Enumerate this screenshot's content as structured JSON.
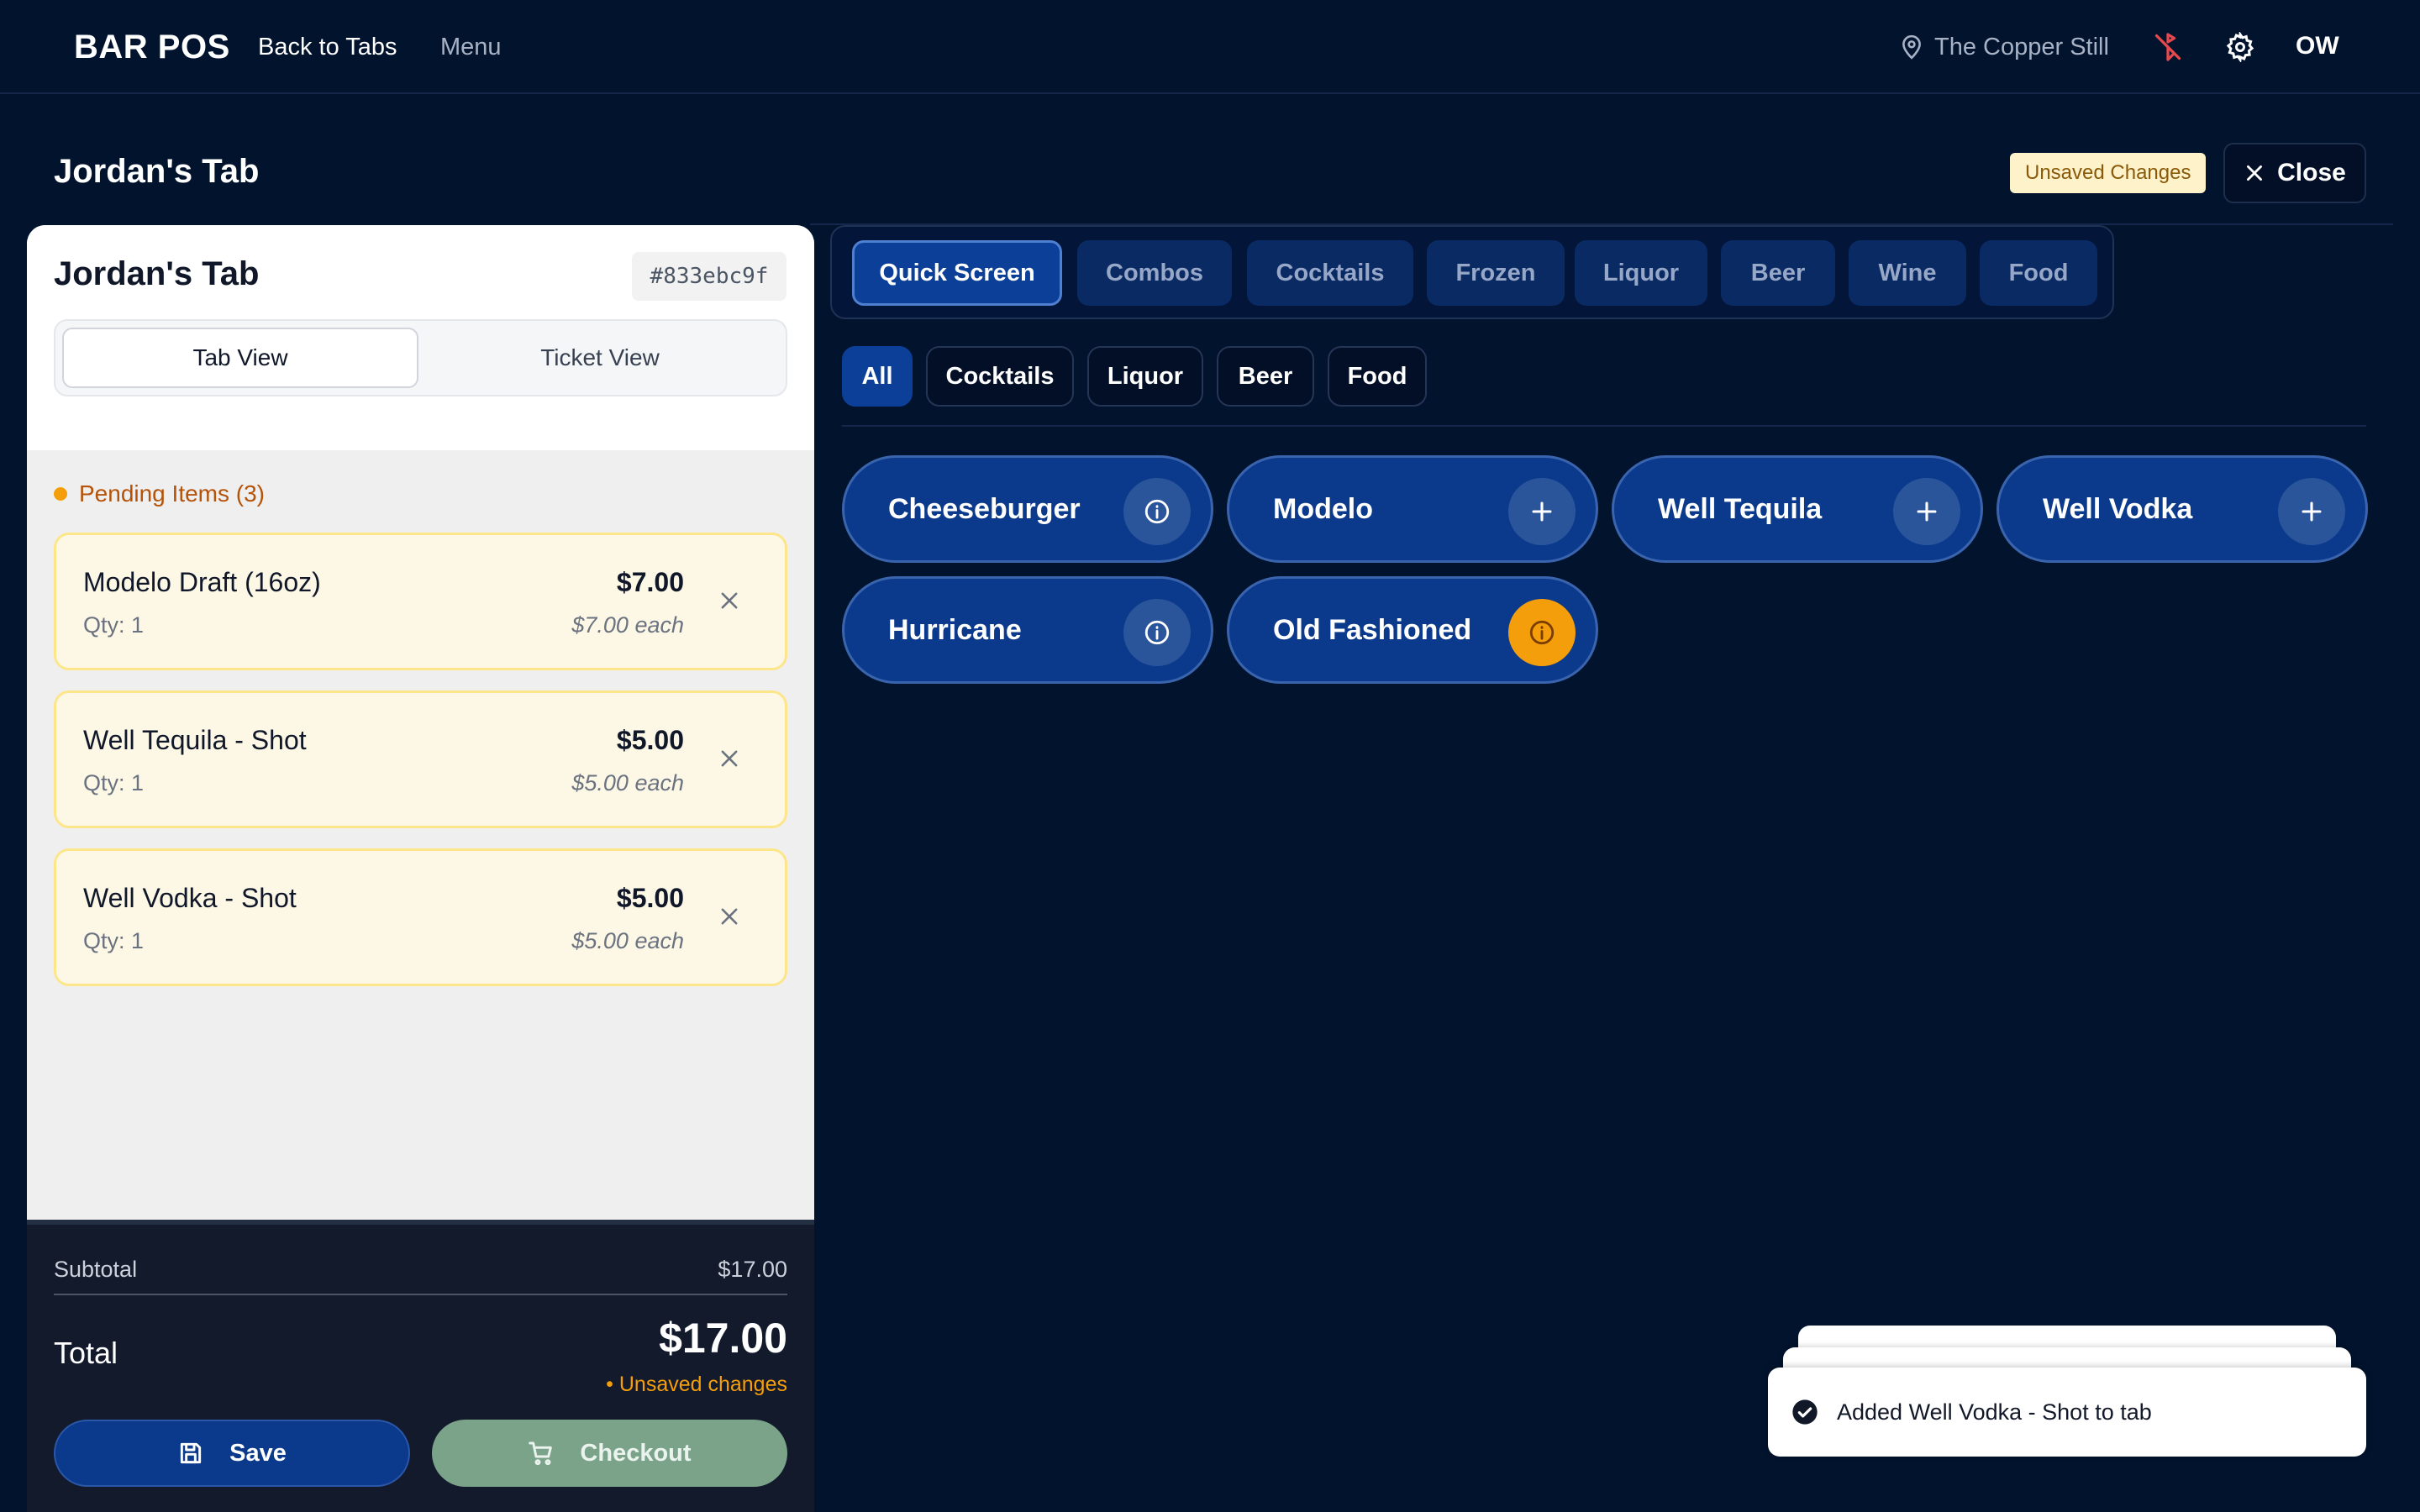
{
  "nav": {
    "brand": "BAR POS",
    "back_label": "Back to Tabs",
    "menu_label": "Menu",
    "location": "The Copper Still",
    "user_initials": "OW"
  },
  "page": {
    "title": "Jordan's Tab",
    "unsaved_badge": "Unsaved Changes",
    "close_label": "Close"
  },
  "tab": {
    "name": "Jordan's Tab",
    "id": "#833ebc9f",
    "views": [
      "Tab View",
      "Ticket View"
    ],
    "active_view": "Tab View",
    "pending_label": "Pending Items (3)",
    "items": [
      {
        "name": "Modelo Draft (16oz)",
        "qty": "Qty: 1",
        "price": "$7.00",
        "each": "$7.00 each"
      },
      {
        "name": "Well Tequila - Shot",
        "qty": "Qty: 1",
        "price": "$5.00",
        "each": "$5.00 each"
      },
      {
        "name": "Well Vodka - Shot",
        "qty": "Qty: 1",
        "price": "$5.00",
        "each": "$5.00 each"
      }
    ]
  },
  "totals": {
    "subtotal_label": "Subtotal",
    "subtotal": "$17.00",
    "total_label": "Total",
    "total": "$17.00",
    "unsaved_note": "• Unsaved changes",
    "save_label": "Save",
    "checkout_label": "Checkout"
  },
  "categories": {
    "tabs": [
      "Quick Screen",
      "Combos",
      "Cocktails",
      "Frozen",
      "Liquor",
      "Beer",
      "Wine",
      "Food"
    ],
    "active": "Quick Screen"
  },
  "filters": {
    "chips": [
      "All",
      "Cocktails",
      "Liquor",
      "Beer",
      "Food"
    ],
    "active": "All"
  },
  "products": [
    {
      "name": "Cheeseburger",
      "action": "info"
    },
    {
      "name": "Modelo",
      "action": "add"
    },
    {
      "name": "Well Tequila",
      "action": "add"
    },
    {
      "name": "Well Vodka",
      "action": "add"
    },
    {
      "name": "Hurricane",
      "action": "info"
    },
    {
      "name": "Old Fashioned",
      "action": "info-warning"
    }
  ],
  "toast": {
    "message": "Added Well Vodka - Shot to tab"
  },
  "colors": {
    "background": "#01132d",
    "primary": "#0b3a8c",
    "accent_warning": "#f59e0b",
    "pending_card": "#fdf8e6",
    "checkout": "#7ba38a"
  }
}
